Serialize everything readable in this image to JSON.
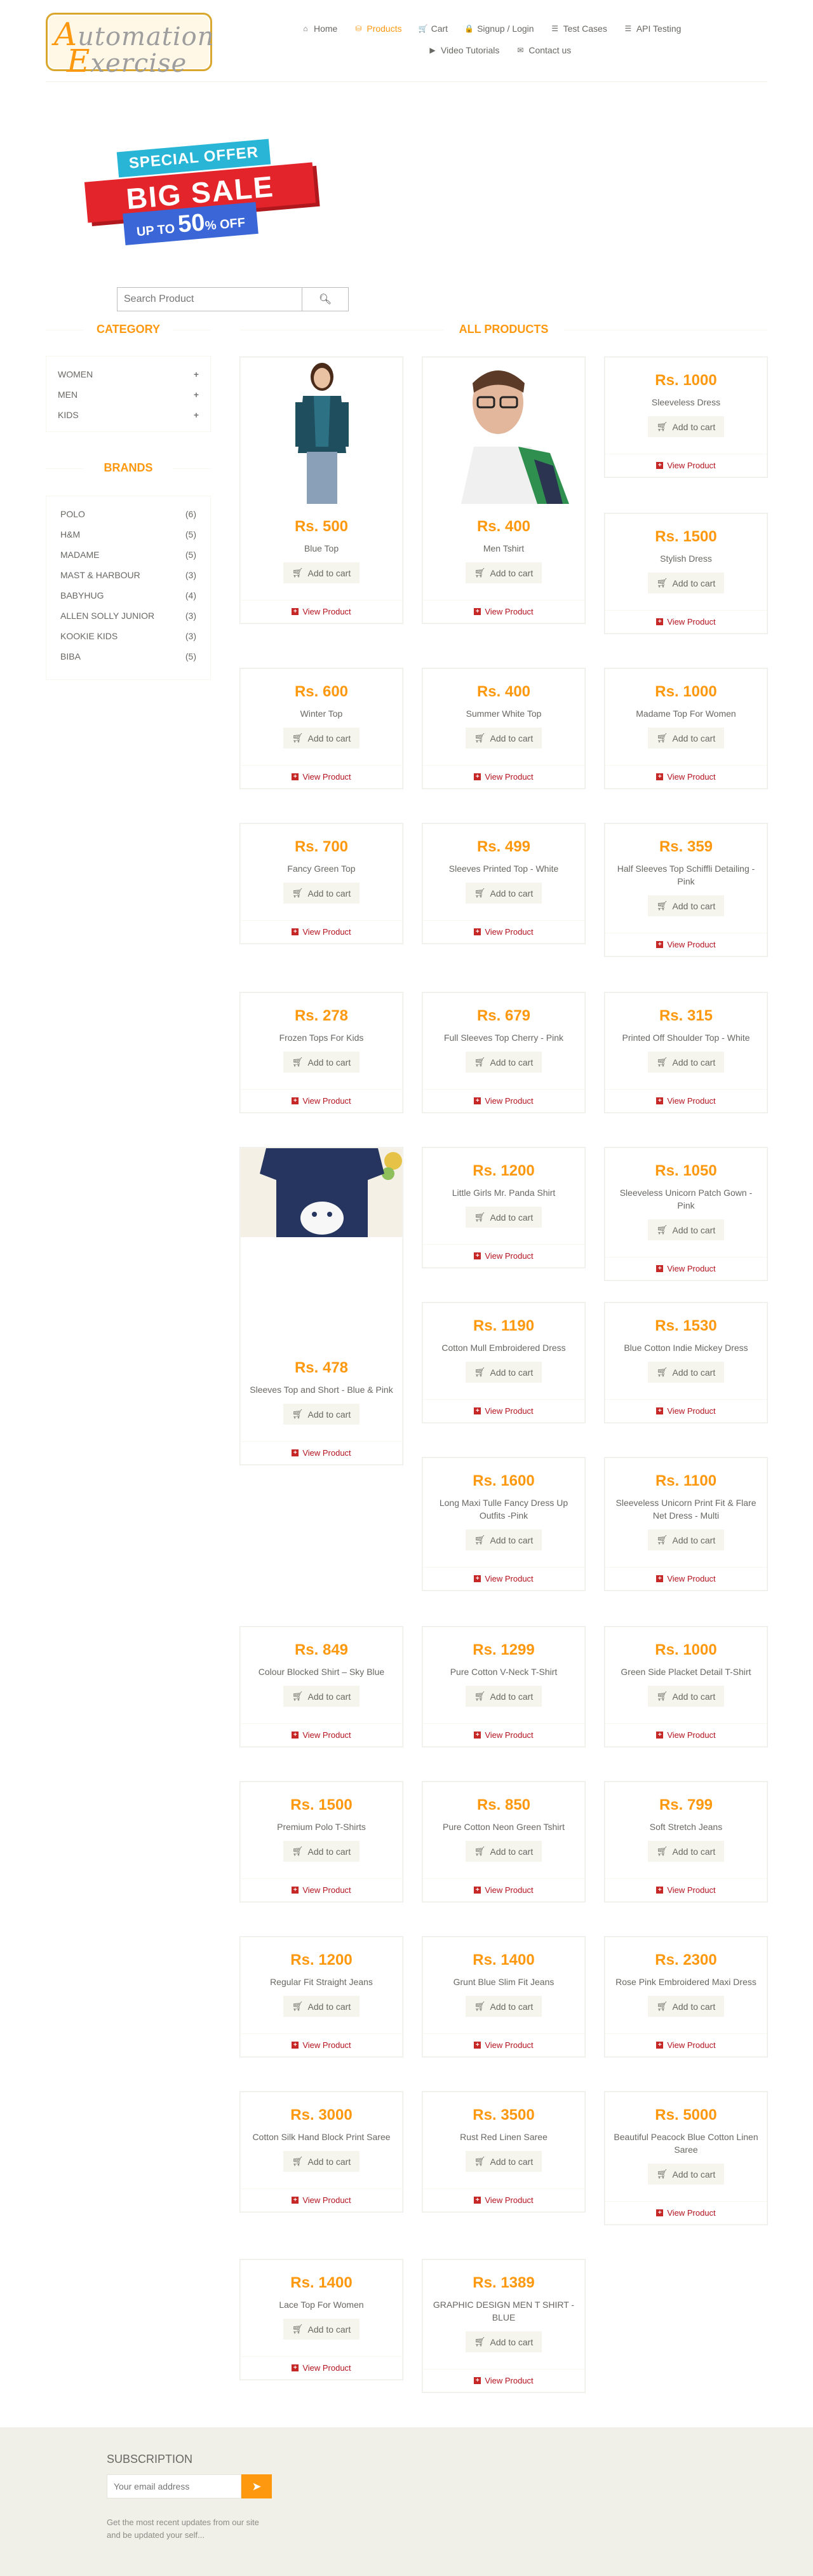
{
  "header": {
    "logo_line1": "utomation",
    "logo_cap1": "A",
    "logo_line2": "xercise",
    "logo_cap2": "E",
    "nav": [
      {
        "label": "Home",
        "icon": "home-icon",
        "glyph": "⌂"
      },
      {
        "label": "Products",
        "icon": "products-icon",
        "glyph": "⛁",
        "active": true
      },
      {
        "label": "Cart",
        "icon": "cart-icon",
        "glyph": "🛒"
      },
      {
        "label": "Signup / Login",
        "icon": "lock-icon",
        "glyph": "🔒"
      },
      {
        "label": "Test Cases",
        "icon": "list-icon",
        "glyph": "☰"
      },
      {
        "label": "API Testing",
        "icon": "list-icon",
        "glyph": "☰"
      },
      {
        "label": "Video Tutorials",
        "icon": "youtube-icon",
        "glyph": "▶"
      },
      {
        "label": "Contact us",
        "icon": "envelope-icon",
        "glyph": "✉"
      }
    ]
  },
  "banner": {
    "special": "SPECIAL OFFER",
    "big": "BIG SALE",
    "upto_prefix": "UP TO",
    "upto_value": "50",
    "upto_suffix": "% OFF"
  },
  "search": {
    "placeholder": "Search Product"
  },
  "sidebar": {
    "category_title": "CATEGORY",
    "categories": [
      "WOMEN",
      "MEN",
      "KIDS"
    ],
    "brands_title": "BRANDS",
    "brands": [
      {
        "name": "POLO",
        "count": "(6)"
      },
      {
        "name": "H&M",
        "count": "(5)"
      },
      {
        "name": "MADAME",
        "count": "(5)"
      },
      {
        "name": "MAST & HARBOUR",
        "count": "(3)"
      },
      {
        "name": "BABYHUG",
        "count": "(4)"
      },
      {
        "name": "ALLEN SOLLY JUNIOR",
        "count": "(3)"
      },
      {
        "name": "KOOKIE KIDS",
        "count": "(3)"
      },
      {
        "name": "BIBA",
        "count": "(5)"
      }
    ]
  },
  "main": {
    "title": "ALL PRODUCTS",
    "add_label": "Add to cart",
    "view_label": "View Product"
  },
  "products": [
    {
      "price": "Rs. 500",
      "name": "Blue Top"
    },
    {
      "price": "Rs. 400",
      "name": "Men Tshirt"
    },
    {
      "price": "Rs. 1000",
      "name": "Sleeveless Dress"
    },
    {
      "price": "Rs. 1500",
      "name": "Stylish Dress"
    },
    {
      "price": "Rs. 600",
      "name": "Winter Top"
    },
    {
      "price": "Rs. 400",
      "name": "Summer White Top"
    },
    {
      "price": "Rs. 1000",
      "name": "Madame Top For Women"
    },
    {
      "price": "Rs. 700",
      "name": "Fancy Green Top"
    },
    {
      "price": "Rs. 499",
      "name": "Sleeves Printed Top - White"
    },
    {
      "price": "Rs. 359",
      "name": "Half Sleeves Top Schiffli Detailing - Pink"
    },
    {
      "price": "Rs. 278",
      "name": "Frozen Tops For Kids"
    },
    {
      "price": "Rs. 679",
      "name": "Full Sleeves Top Cherry - Pink"
    },
    {
      "price": "Rs. 315",
      "name": "Printed Off Shoulder Top - White"
    },
    {
      "price": "Rs. 478",
      "name": "Sleeves Top and Short - Blue & Pink"
    },
    {
      "price": "Rs. 1200",
      "name": "Little Girls Mr. Panda Shirt"
    },
    {
      "price": "Rs. 1050",
      "name": "Sleeveless Unicorn Patch Gown - Pink"
    },
    {
      "price": "Rs. 1190",
      "name": "Cotton Mull Embroidered Dress"
    },
    {
      "price": "Rs. 1530",
      "name": "Blue Cotton Indie Mickey Dress"
    },
    {
      "price": "Rs. 1600",
      "name": "Long Maxi Tulle Fancy Dress Up Outfits -Pink"
    },
    {
      "price": "Rs. 1100",
      "name": "Sleeveless Unicorn Print Fit & Flare Net Dress - Multi"
    },
    {
      "price": "Rs. 849",
      "name": "Colour Blocked Shirt – Sky Blue"
    },
    {
      "price": "Rs. 1299",
      "name": "Pure Cotton V-Neck T-Shirt"
    },
    {
      "price": "Rs. 1000",
      "name": "Green Side Placket Detail T-Shirt"
    },
    {
      "price": "Rs. 1500",
      "name": "Premium Polo T-Shirts"
    },
    {
      "price": "Rs. 850",
      "name": "Pure Cotton Neon Green Tshirt"
    },
    {
      "price": "Rs. 799",
      "name": "Soft Stretch Jeans"
    },
    {
      "price": "Rs. 1200",
      "name": "Regular Fit Straight Jeans"
    },
    {
      "price": "Rs. 1400",
      "name": "Grunt Blue Slim Fit Jeans"
    },
    {
      "price": "Rs. 2300",
      "name": "Rose Pink Embroidered Maxi Dress"
    },
    {
      "price": "Rs. 3000",
      "name": "Cotton Silk Hand Block Print Saree"
    },
    {
      "price": "Rs. 3500",
      "name": "Rust Red Linen Saree"
    },
    {
      "price": "Rs. 5000",
      "name": "Beautiful Peacock Blue Cotton Linen Saree"
    },
    {
      "price": "Rs. 1400",
      "name": "Lace Top For Women"
    },
    {
      "price": "Rs. 1389",
      "name": "GRAPHIC DESIGN MEN T SHIRT - BLUE"
    }
  ],
  "footer": {
    "subscription_title": "SUBSCRIPTION",
    "email_placeholder": "Your email address",
    "note": "Get the most recent updates from our site and be updated your self..."
  },
  "colors": {
    "accent": "#FE980F",
    "view_link": "#B4131F",
    "footer_bg": "#F0F0E9"
  }
}
